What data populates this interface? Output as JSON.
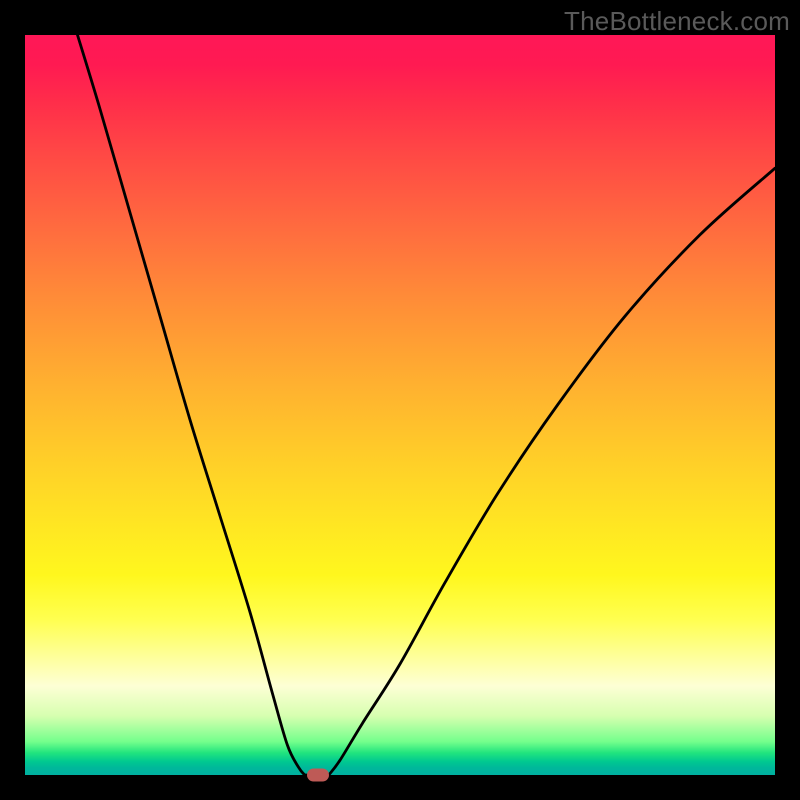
{
  "watermark": "TheBottleneck.com",
  "colors": {
    "frame": "#000000",
    "curve": "#000000",
    "marker": "#be5a56",
    "watermark": "#5a5a5a"
  },
  "chart_data": {
    "type": "line",
    "title": "",
    "xlabel": "",
    "ylabel": "",
    "xlim": [
      0,
      100
    ],
    "ylim": [
      0,
      100
    ],
    "grid": false,
    "legend": false,
    "series": [
      {
        "name": "bottleneck-curve-left",
        "x": [
          7,
          10,
          14,
          18,
          22,
          26,
          30,
          33,
          35,
          36.5,
          37.3
        ],
        "y": [
          100,
          90,
          76,
          62,
          48,
          35,
          22,
          11,
          4,
          1,
          0
        ]
      },
      {
        "name": "bottleneck-curve-right",
        "x": [
          40.5,
          42,
          45,
          50,
          56,
          63,
          71,
          80,
          90,
          100
        ],
        "y": [
          0,
          2,
          7,
          15,
          26,
          38,
          50,
          62,
          73,
          82
        ]
      }
    ],
    "flat_segment": {
      "x": [
        37.3,
        40.5
      ],
      "y": 0
    },
    "marker": {
      "x": 39,
      "y": 0,
      "shape": "rounded-rect",
      "color": "#be5a56"
    },
    "background_gradient": {
      "orientation": "vertical",
      "stops": [
        {
          "pos": 0.0,
          "color": "#ff1757"
        },
        {
          "pos": 0.26,
          "color": "#ff6b3f"
        },
        {
          "pos": 0.58,
          "color": "#ffd028"
        },
        {
          "pos": 0.79,
          "color": "#ffff50"
        },
        {
          "pos": 0.92,
          "color": "#d7ffb0"
        },
        {
          "pos": 0.97,
          "color": "#21e47e"
        },
        {
          "pos": 1.0,
          "color": "#00b0a0"
        }
      ]
    }
  }
}
